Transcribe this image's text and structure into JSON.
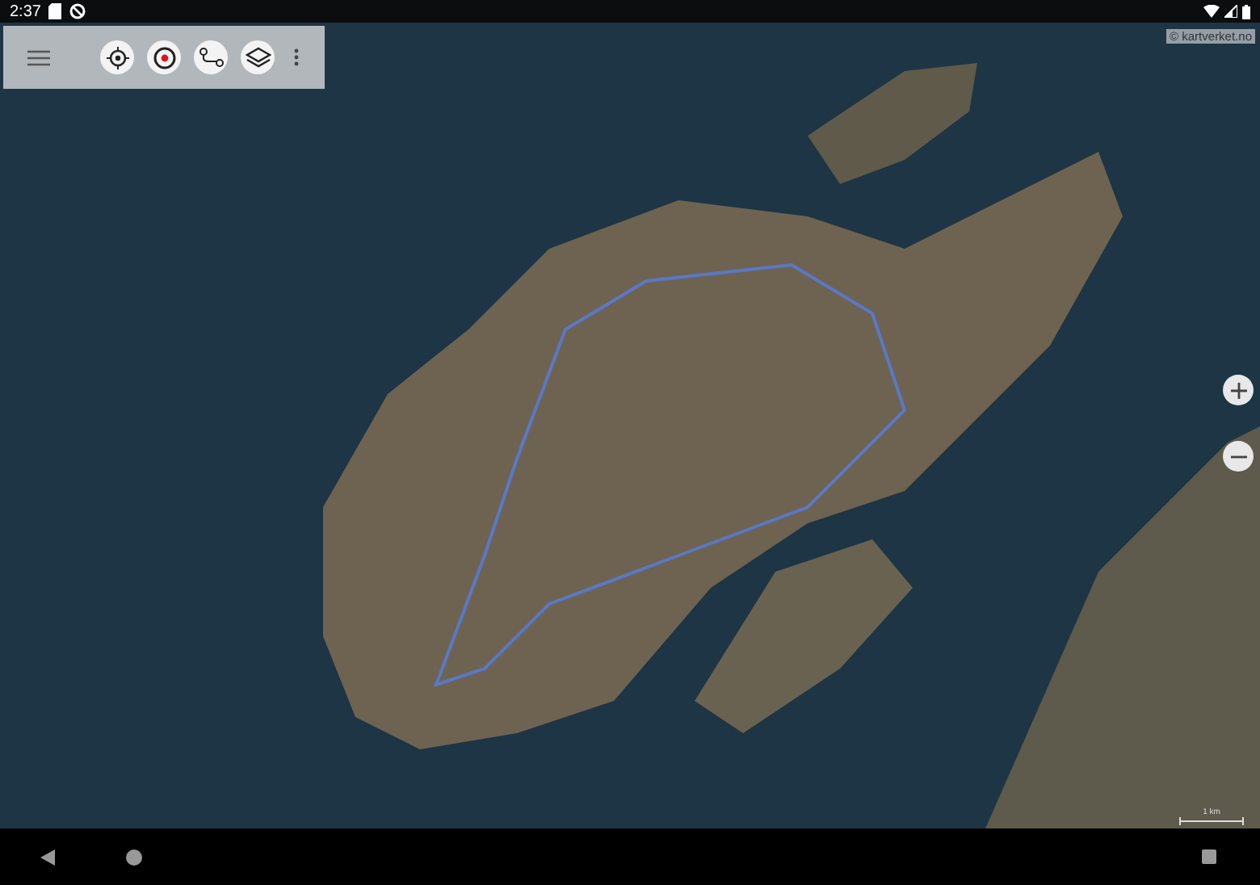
{
  "status_bar": {
    "time": "2:37"
  },
  "map": {
    "attribution": "© kartverket.no",
    "scale_label": "1 km"
  }
}
